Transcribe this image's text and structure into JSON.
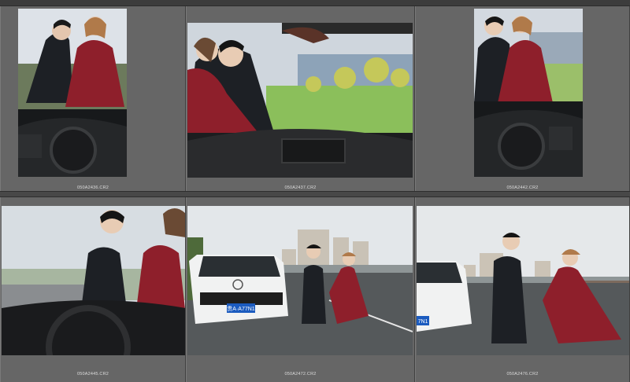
{
  "grid": {
    "cells": [
      {
        "filename": "050A2436.CR2"
      },
      {
        "filename": "050A2437.CR2"
      },
      {
        "filename": "050A2442.CR2"
      },
      {
        "filename": "050A2445.CR2"
      },
      {
        "filename": "050A2472.CR2"
      },
      {
        "filename": "050A2476.CR2"
      }
    ],
    "plates": [
      "贵A·A77N1",
      "7N1"
    ]
  },
  "colors": {
    "panel": "#666666",
    "background": "#3a3a3a",
    "dress": "#8e1f2b",
    "suit": "#1d2025"
  }
}
